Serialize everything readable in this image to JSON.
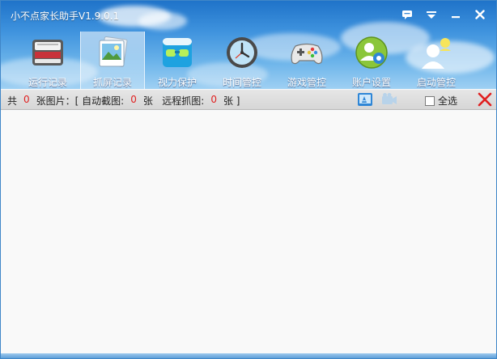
{
  "app": {
    "title": "小不点家长助手V1.9.0.1"
  },
  "window_controls": {
    "chat_icon": "chat-icon",
    "menu_icon": "menu-down-icon",
    "minimize": "—",
    "close": "✕"
  },
  "nav": {
    "tabs": [
      {
        "label": "运行记录",
        "icon": "run-record-icon"
      },
      {
        "label": "抓屏记录",
        "icon": "screenshot-record-icon",
        "active": true
      },
      {
        "label": "视力保护",
        "icon": "eye-protect-icon"
      },
      {
        "label": "时间管控",
        "icon": "clock-icon"
      },
      {
        "label": "游戏管控",
        "icon": "gamepad-icon"
      },
      {
        "label": "账户设置",
        "icon": "account-settings-icon"
      },
      {
        "label": "启动管控",
        "icon": "startup-control-icon"
      }
    ]
  },
  "toolbar": {
    "total_prefix": "共",
    "total_count": "0",
    "total_suffix": "张图片：[ 自动截图:",
    "auto_count": "0",
    "auto_suffix": "张   远程抓图:",
    "remote_count": "0",
    "remote_suffix": "张 ]",
    "select_all_label": "全选"
  },
  "colors": {
    "accent": "#2f86d6",
    "count_red": "#e02020",
    "delete_red": "#e02020"
  }
}
